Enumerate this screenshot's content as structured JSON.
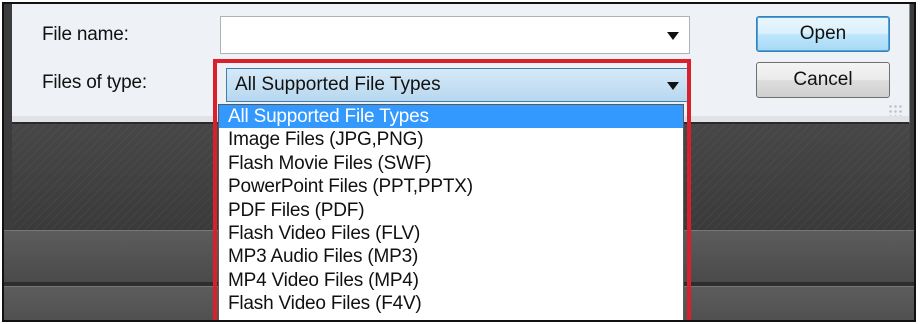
{
  "dialog": {
    "file_name_label": "File name:",
    "file_name_value": "",
    "files_of_type_label": "Files of type:",
    "files_of_type_selected": "All Supported File Types",
    "open_button": "Open",
    "cancel_button": "Cancel"
  },
  "file_type_options": [
    "All Supported File Types",
    "Image Files (JPG,PNG)",
    "Flash Movie Files (SWF)",
    "PowerPoint Files (PPT,PPTX)",
    "PDF Files (PDF)",
    "Flash Video Files (FLV)",
    "MP3 Audio Files (MP3)",
    "MP4 Video Files (MP4)",
    "Flash Video Files (F4V)"
  ],
  "selected_option_index": 0,
  "icons": {
    "dropdown_arrow": "chevron-down-icon",
    "resize_grip": "resize-grip-icon"
  },
  "colors": {
    "selection": "#3399ff",
    "highlight_outline": "#d9202c",
    "open_button_border": "#3c7fb1"
  }
}
